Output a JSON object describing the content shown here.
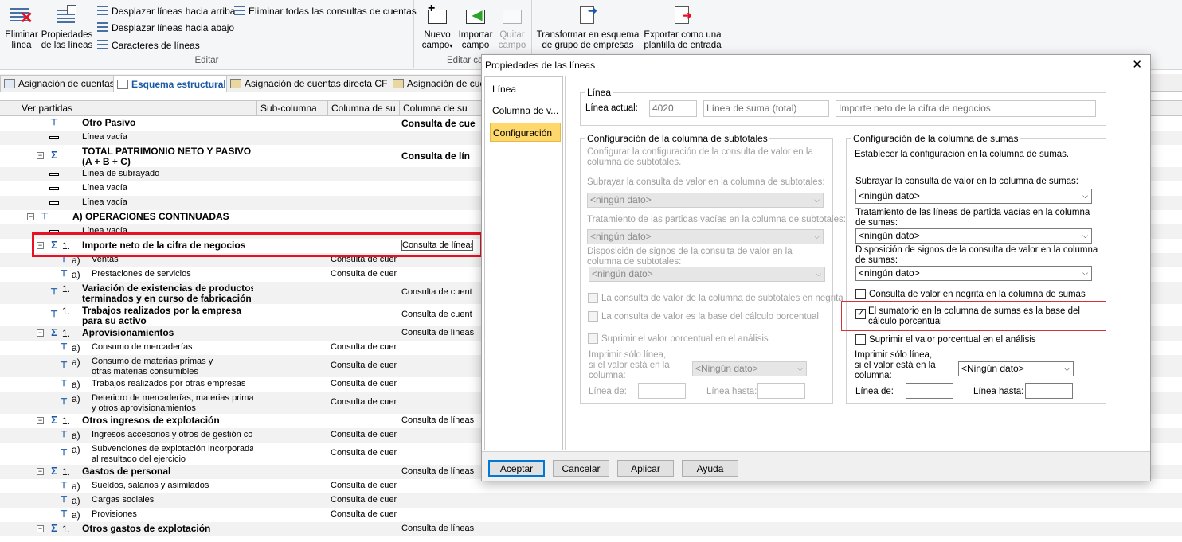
{
  "ribbon": {
    "buttons": {
      "delete_line": "Eliminar\nlínea",
      "line_props": "Propiedades\nde las líneas",
      "move_up": "Desplazar líneas hacia arriba",
      "move_down": "Desplazar líneas hacia abajo",
      "line_chars": "Caracteres de líneas",
      "delete_all_queries": "Eliminar todas las consultas de cuentas",
      "new_field": "Nuevo\ncampo",
      "import_field": "Importar\ncampo",
      "remove_field": "Quitar\ncampo",
      "transform": "Transformar en esquema\nde grupo de empresas",
      "export_template": "Exportar como una\nplantilla de entrada"
    },
    "groups": {
      "edit": "Editar",
      "edit_field": "Editar ca"
    }
  },
  "tabs": [
    {
      "label": "Asignación de cuentas"
    },
    {
      "label": "Esquema estructural"
    },
    {
      "label": "Asignación de cuentas directa CF"
    },
    {
      "label": "Asignación de cue"
    }
  ],
  "grid": {
    "headers": [
      "Ver partidas",
      "Sub-columna",
      "Columna de su",
      "Columna de su"
    ],
    "rows": [
      {
        "icon": "tree",
        "num": "",
        "text": "Otro Pasivo",
        "bold": true,
        "col3": "",
        "col4": "Consulta de cue"
      },
      {
        "icon": "line",
        "num": "",
        "text": "Línea vacía",
        "bold": false,
        "col3": "",
        "col4": ""
      },
      {
        "icon": "sum",
        "num": "",
        "text": "TOTAL PATRIMONIO NETO Y PASIVO\n(A + B + C)",
        "bold": true,
        "col3": "",
        "col4": "Consulta de lín"
      },
      {
        "icon": "line",
        "num": "",
        "text": "Línea de subrayado",
        "bold": false,
        "col3": "",
        "col4": ""
      },
      {
        "icon": "line",
        "num": "",
        "text": "Línea vacía",
        "bold": false,
        "col3": "",
        "col4": ""
      },
      {
        "icon": "line",
        "num": "",
        "text": "Línea vacía",
        "bold": false,
        "col3": "",
        "col4": ""
      },
      {
        "icon": "tree",
        "num": "",
        "text": "A) OPERACIONES CONTINUADAS",
        "bold": true,
        "col3": "",
        "col4": ""
      },
      {
        "icon": "line",
        "num": "",
        "text": "Línea vacía",
        "bold": false,
        "col3": "",
        "col4": ""
      },
      {
        "icon": "sum",
        "num": "1.",
        "text": "Importe neto de la cifra de negocios",
        "bold": true,
        "col3": "",
        "col4": "Consulta de líneas"
      },
      {
        "icon": "tree",
        "num": "a)",
        "text": "Ventas",
        "bold": false,
        "col3": "Consulta de cuent",
        "col4": ""
      },
      {
        "icon": "tree",
        "num": "a)",
        "text": "Prestaciones de servicios",
        "bold": false,
        "col3": "Consulta de cuent",
        "col4": ""
      },
      {
        "icon": "tree",
        "num": "1.",
        "text": "Variación de existencias de productos\nterminados y en curso de fabricación",
        "bold": true,
        "col3": "",
        "col4": "Consulta de cuent"
      },
      {
        "icon": "tree",
        "num": "1.",
        "text": "Trabajos realizados por la empresa\npara su activo",
        "bold": true,
        "col3": "",
        "col4": "Consulta de cuent"
      },
      {
        "icon": "sum",
        "num": "1.",
        "text": "Aprovisionamientos",
        "bold": true,
        "col3": "",
        "col4": "Consulta de líneas"
      },
      {
        "icon": "tree",
        "num": "a)",
        "text": "Consumo de mercaderías",
        "bold": false,
        "col3": "Consulta de cuent",
        "col4": ""
      },
      {
        "icon": "tree",
        "num": "a)",
        "text": "Consumo de materias primas y\notras materias consumibles",
        "bold": false,
        "col3": "Consulta de cuent",
        "col4": ""
      },
      {
        "icon": "tree",
        "num": "a)",
        "text": "Trabajos realizados por otras empresas",
        "bold": false,
        "col3": "Consulta de cuent",
        "col4": ""
      },
      {
        "icon": "tree",
        "num": "a)",
        "text": "Deterioro de mercaderías, materias primas\ny otros aprovisionamientos",
        "bold": false,
        "col3": "Consulta de cuent",
        "col4": ""
      },
      {
        "icon": "sum",
        "num": "1.",
        "text": "Otros ingresos de explotación",
        "bold": true,
        "col3": "",
        "col4": "Consulta de líneas"
      },
      {
        "icon": "tree",
        "num": "a)",
        "text": "Ingresos accesorios y otros de gestión corri",
        "bold": false,
        "col3": "Consulta de cuent",
        "col4": ""
      },
      {
        "icon": "tree",
        "num": "a)",
        "text": "Subvenciones de explotación incorporadas\nal resultado del ejercicio",
        "bold": false,
        "col3": "Consulta de cuent",
        "col4": ""
      },
      {
        "icon": "sum",
        "num": "1.",
        "text": "Gastos de personal",
        "bold": true,
        "col3": "",
        "col4": "Consulta de líneas"
      },
      {
        "icon": "tree",
        "num": "a)",
        "text": "Sueldos, salarios y asimilados",
        "bold": false,
        "col3": "Consulta de cuent",
        "col4": ""
      },
      {
        "icon": "tree",
        "num": "a)",
        "text": "Cargas sociales",
        "bold": false,
        "col3": "Consulta de cuent",
        "col4": ""
      },
      {
        "icon": "tree",
        "num": "a)",
        "text": "Provisiones",
        "bold": false,
        "col3": "Consulta de cuent",
        "col4": ""
      },
      {
        "icon": "sum",
        "num": "1.",
        "text": "Otros gastos de explotación",
        "bold": true,
        "col3": "",
        "col4": "Consulta de líneas"
      }
    ]
  },
  "dialog": {
    "title": "Propiedades de las líneas",
    "nav": [
      "Línea",
      "Columna de v...",
      "Configuración"
    ],
    "linea": {
      "legend": "Línea",
      "current_label": "Línea actual:",
      "current_value": "4020",
      "type_value": "Línea de suma (total)",
      "desc_value": "Importe neto de la cifra de negocios"
    },
    "subtotals": {
      "legend": "Configuración de la columna de subtotales",
      "desc": "Configurar la configuración de la consulta de valor en la columna de subtotales.",
      "underline_label": "Subrayar la consulta de valor en la columna de subtotales:",
      "underline_value": "<ningún dato>",
      "empty_label": "Tratamiento de las partidas vacías en la columna de subtotales:",
      "empty_value": "<ningún dato>",
      "sign_label": "Disposición de signos de la consulta de valor en la columna de subtotales:",
      "sign_value": "<ningún dato>",
      "bold_label": "La consulta de valor de la columna de subtotales en negrita",
      "base_label": "La consulta de valor es la base del cálculo porcentual",
      "suppress_label": "Suprimir el valor porcentual en el análisis",
      "print_only_label": "Imprimir sólo línea,\nsi el valor está en la\ncolumna:",
      "print_only_value": "<Ningún dato>",
      "from_label": "Línea de:",
      "to_label": "Línea hasta:"
    },
    "sums": {
      "legend": "Configuración de la columna de sumas",
      "desc": "Establecer la configuración en la columna de sumas.",
      "underline_label": "Subrayar la consulta de valor en la columna de sumas:",
      "underline_value": "<ningún dato>",
      "empty_label": "Tratamiento de las líneas de partida vacías en la columna de sumas:",
      "empty_value": "<ningún dato>",
      "sign_label": "Disposición de signos de la consulta de valor en la columna de sumas:",
      "sign_value": "<ningún dato>",
      "bold_label": "Consulta de valor en negrita en la columna de sumas",
      "base_label": "El sumatorio en la columna de sumas es la base del cálculo porcentual",
      "suppress_label": "Suprimir el valor porcentual en el análisis",
      "print_only_label": "Imprimir sólo línea,\nsi el valor está en la\ncolumna:",
      "print_only_value": "<Ningún dato>",
      "from_label": "Línea de:",
      "to_label": "Línea hasta:"
    },
    "buttons": {
      "ok": "Aceptar",
      "cancel": "Cancelar",
      "apply": "Aplicar",
      "help": "Ayuda"
    }
  }
}
